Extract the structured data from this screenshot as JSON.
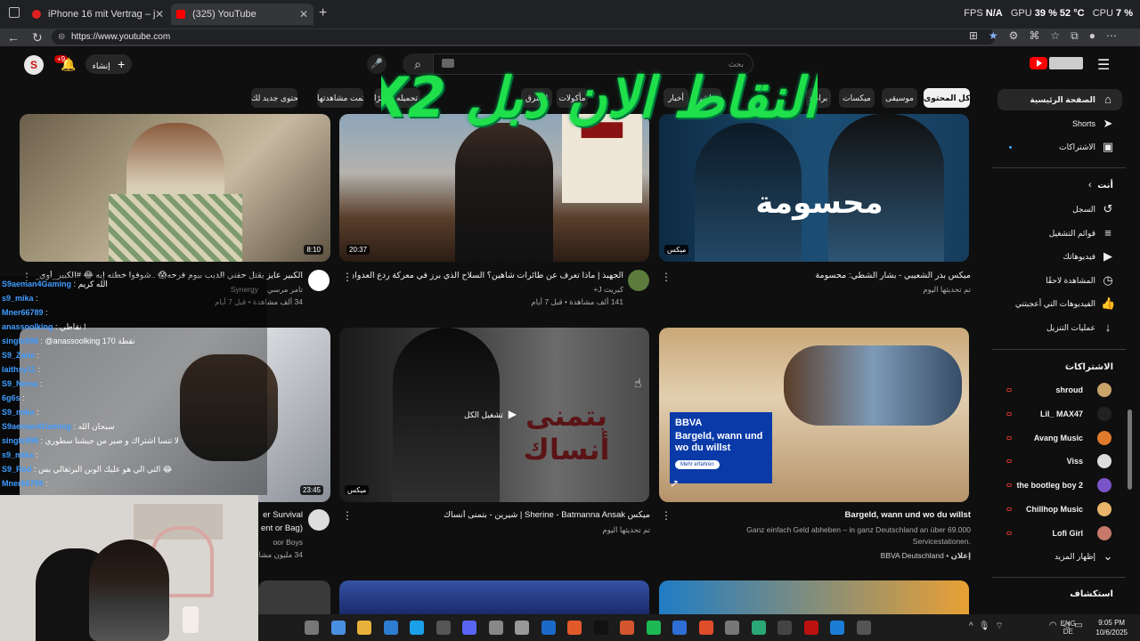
{
  "browser": {
    "tabs": [
      {
        "title": "iPhone 16 mit Vertrag – jetzt best"
      },
      {
        "title": "(325) YouTube"
      }
    ],
    "url": "https://www.youtube.com",
    "perf": {
      "fps_label": "FPS",
      "fps": "N/A",
      "gpu_label": "GPU",
      "gpu": "39 %",
      "gpu_temp": "52 °C",
      "cpu_label": "CPU",
      "cpu": "7 %"
    }
  },
  "header": {
    "create_label": "إنشاء",
    "notifications_badge": "+9",
    "search_placeholder": "بحث"
  },
  "overlay_text": "النقاط الان دبل X2",
  "chips": [
    {
      "label": "كل المحتوى",
      "active": true
    },
    {
      "label": "موسيقى"
    },
    {
      "label": "ميكسات"
    },
    {
      "label": "برامج"
    },
    {
      "label": "أخبار"
    },
    {
      "label": "مباشر"
    },
    {
      "label": "مأكولات"
    },
    {
      "label": "الشرق"
    },
    {
      "label": "المحتوى الذي تم تحميله مؤخرًا"
    },
    {
      "label": "تمت مشاهدتها"
    },
    {
      "label": "محتوى جديد لك"
    }
  ],
  "sidebar": {
    "main": [
      {
        "label": "الصفحة الرئيسية",
        "icon": "home-icon",
        "active": true
      },
      {
        "label": "Shorts",
        "icon": "shorts-icon"
      },
      {
        "label": "الاشتراكات",
        "icon": "subscriptions-icon"
      }
    ],
    "you_heading": "أنت",
    "you": [
      {
        "label": "السجل",
        "icon": "history-icon"
      },
      {
        "label": "قوائم التشغيل",
        "icon": "playlist-icon"
      },
      {
        "label": "فيديوهاتك",
        "icon": "your-videos-icon"
      },
      {
        "label": "المشاهدة لاحقًا",
        "icon": "watch-later-icon"
      },
      {
        "label": "الفيديوهات التي أعجبتني",
        "icon": "like-icon"
      },
      {
        "label": "عمليات التنزيل",
        "icon": "download-icon"
      }
    ],
    "subs_heading": "الاشتراكات",
    "subscriptions": [
      {
        "name": "shroud",
        "color": "#c9a36a"
      },
      {
        "name": "Lil_ MAX47",
        "color": "#222222"
      },
      {
        "name": "Avang Music",
        "color": "#e07a2c"
      },
      {
        "name": "Viss",
        "color": "#dddddd"
      },
      {
        "name": "the bootleg boy 2",
        "color": "#7a55c8"
      },
      {
        "name": "Chillhop Music",
        "color": "#e9b56a"
      },
      {
        "name": "Lofi Girl",
        "color": "#c77a6a"
      }
    ],
    "show_more": "إظهار المزيد",
    "explore_heading": "استكشاف"
  },
  "videos": [
    {
      "title": "الكبير عايز يقتل حفني الديب بيوم فرحه😱 ..شوفوا خطته إيه 😂 #الكبير_أوي_7",
      "channel": "Synergy",
      "sub": "تامر مرسي",
      "meta": "34 ألف مشاهدة • قبل 7 أيام",
      "duration": "8:10"
    },
    {
      "title": "الجهبذ | ماذا تعرف عن طائرات شاهين؟ السلاح الذي برز في معركة ردع العدوان؟",
      "channel": "كبريت J+",
      "meta": "141 ألف مشاهدة • قبل 7 أيام",
      "duration": "20:37"
    },
    {
      "title": "ميكس بدر الشعيبي - بشار الشطي: محسومة",
      "meta": "تم تحديثها اليوم",
      "duration": "ميكس",
      "thumb_text": "محسومة"
    },
    {
      "title": "er Survival",
      "title2": "ent or Bag)",
      "channel": "oor Boys",
      "meta": "34 مليون مشاهدة",
      "duration": "23:45"
    },
    {
      "title": "ميكس Sherine - Batmanna Ansak | شيرين - بتمنى أنساك",
      "meta": "تم تحديثها اليوم",
      "duration": "ميكس",
      "play_all": "تشغيل الكل",
      "thumb_text": "بتمنى أنساك"
    },
    {
      "title": "Bargeld, wann und wo du willst",
      "desc1": "Ganz einfach Geld abheben – in ganz Deutschland an über 69.000",
      "desc2": "Servicestationen.",
      "ad_label": "إعلان",
      "channel": "BBVA Deutschland",
      "ad_brand": "BBVA",
      "ad_headline": "Bargeld, wann und wo du willst",
      "ad_button": "Mehr erfahren"
    }
  ],
  "chat": [
    {
      "user": "S9aeman4Gaming",
      "msg": ": الله كريم"
    },
    {
      "user": "s9_mika",
      "msg": ":"
    },
    {
      "user": "Mner66789",
      "msg": ":"
    },
    {
      "user": "anassoolking",
      "msg": ": نقاطي !"
    },
    {
      "user": "single998",
      "msg": ": @anassoolking 170 نقطة"
    },
    {
      "user": "S9_Zane",
      "msg": ":"
    },
    {
      "user": "laithsy11",
      "msg": ":"
    },
    {
      "user": "S9_Nema",
      "msg": ":"
    },
    {
      "user": "6g6s",
      "msg": ":"
    },
    {
      "user": "S9_mika",
      "msg": ":"
    },
    {
      "user": "S9aeman4Gaming",
      "msg": ": سبحان الله"
    },
    {
      "user": "single998",
      "msg": ": لا تنسا اشتراك و صبر من جيشنا سطوري"
    },
    {
      "user": "s9_mika",
      "msg": ":"
    },
    {
      "user": "S9_Rod",
      "msg": ": التي الي هو عليك الوبن البرتغالي بس 😂"
    },
    {
      "user": "Mner66789",
      "msg": ":"
    }
  ],
  "taskbar": {
    "lang1": "ENG",
    "lang2": "DE",
    "time": "9:05 PM",
    "date": "10/6/2025"
  }
}
